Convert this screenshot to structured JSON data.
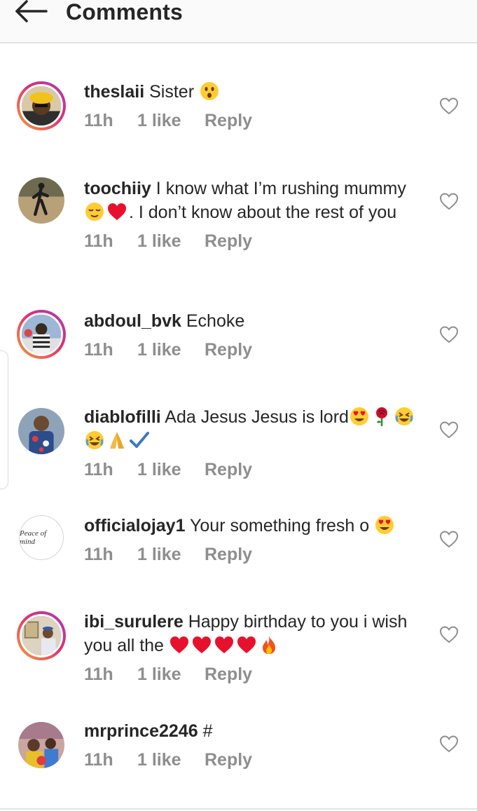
{
  "header": {
    "title": "Comments",
    "back_icon": "arrow-left-icon"
  },
  "comments": [
    {
      "username": "theslaii",
      "text": "Sister",
      "emojis": [
        "astonished"
      ],
      "text_after": "",
      "time": "11h",
      "likes": "1 like",
      "reply": "Reply"
    },
    {
      "username": "toochiiy",
      "text": "I know what I’m rushing mummy",
      "emojis": [
        "relieved",
        "red-heart"
      ],
      "text_after": ". I don’t know about the rest of you",
      "time": "11h",
      "likes": "1 like",
      "reply": "Reply"
    },
    {
      "username": "abdoul_bvk",
      "text": "Echoke",
      "emojis": [],
      "text_after": "",
      "time": "11h",
      "likes": "1 like",
      "reply": "Reply"
    },
    {
      "username": "diablofilli",
      "text": "Ada Jesus  Jesus is lord",
      "emojis": [
        "heart-eyes",
        "rose",
        "rolling-laughing",
        "rolling-laughing",
        "folded-hands",
        "check-mark"
      ],
      "text_after": "",
      "time": "11h",
      "likes": "1 like",
      "reply": "Reply"
    },
    {
      "username": "officialojay1",
      "avatar_text": "Peace of mind",
      "text": "Your something fresh o",
      "emojis": [
        "heart-eyes"
      ],
      "text_after": "",
      "time": "11h",
      "likes": "1 like",
      "reply": "Reply"
    },
    {
      "username": "ibi_surulere",
      "text": "Happy birthday to you i wish you all the",
      "emojis": [
        "red-heart",
        "red-heart",
        "red-heart",
        "red-heart",
        "fire"
      ],
      "text_after": "",
      "time": "11h",
      "likes": "1 like",
      "reply": "Reply"
    },
    {
      "username": "mrprince2246",
      "text": "#",
      "emojis": [],
      "text_after": "",
      "time": "11h",
      "likes": "1 like",
      "reply": "Reply"
    }
  ],
  "colors": {
    "text": "#262626",
    "meta": "#8e8e8e",
    "divider": "#e3e3e3",
    "header_bg": "#fafafa"
  }
}
